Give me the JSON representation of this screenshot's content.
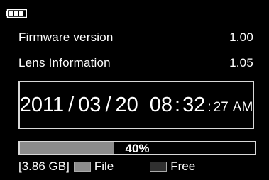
{
  "status": {
    "battery_icon": "battery-icon"
  },
  "info": {
    "firmware_label": "Firmware version",
    "firmware_value": "1.00",
    "lens_label": "Lens Information",
    "lens_value": "1.05"
  },
  "datetime": {
    "year": "2011",
    "month": "03",
    "day": "20",
    "hour": "08",
    "minute": "32",
    "second": "27",
    "ampm": "AM",
    "date_sep": "/",
    "time_sep": ":"
  },
  "storage": {
    "used_percent": 40,
    "used_label": "40%",
    "capacity_label": "[3.86 GB]",
    "file_label": "File",
    "free_label": "Free",
    "file_color": "#8c8c8c",
    "free_color": "#303030"
  }
}
